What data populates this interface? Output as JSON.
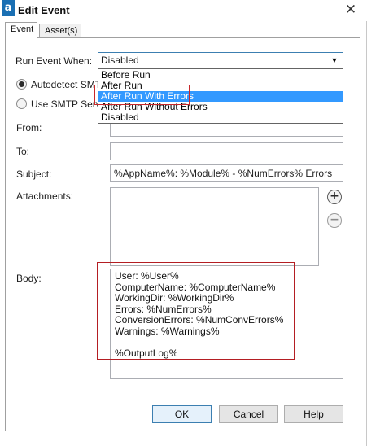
{
  "window": {
    "title": "Edit Event",
    "app_icon_letter": "a",
    "close_glyph": "✕"
  },
  "tabs": [
    {
      "label": "Event",
      "active": true
    },
    {
      "label": "Asset(s)",
      "active": false
    }
  ],
  "run_event": {
    "label": "Run Event When:",
    "selected": "Disabled",
    "options": [
      "Before Run",
      "After Run",
      "After Run With Errors",
      "After Run Without Errors",
      "Disabled"
    ],
    "highlighted_option": "After Run With Errors"
  },
  "smtp": {
    "autodetect_label": "Autodetect SMTP",
    "use_server_label": "Use SMTP Server"
  },
  "form": {
    "from_label": "From:",
    "from_value": "",
    "to_label": "To:",
    "to_value": "",
    "subject_label": "Subject:",
    "subject_value": "%AppName%: %Module% - %NumErrors% Errors",
    "attachments_label": "Attachments:",
    "body_label": "Body:",
    "body_lines": [
      "User: %User%",
      "ComputerName: %ComputerName%",
      "WorkingDir: %WorkingDir%",
      "Errors: %NumErrors%",
      "ConversionErrors: %NumConvErrors%",
      "Warnings: %Warnings%",
      "",
      "%OutputLog%"
    ]
  },
  "icons": {
    "add": "add-attachment-icon",
    "remove": "remove-attachment-icon",
    "add_glyph": "+",
    "remove_glyph": "−",
    "dropdown_glyph": "▼"
  },
  "buttons": {
    "ok": "OK",
    "cancel": "Cancel",
    "help": "Help"
  },
  "colors": {
    "selection": "#3399ff",
    "annotation": "#c8282b",
    "app_icon": "#1a6fb3"
  }
}
